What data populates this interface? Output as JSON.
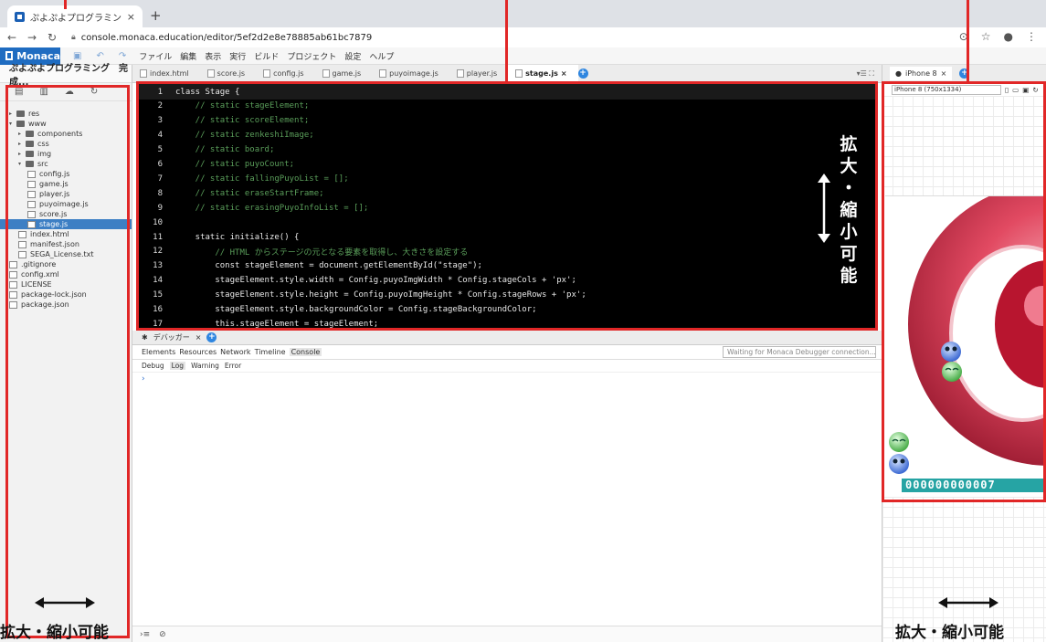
{
  "browser": {
    "tab_title": "ぷよぷよプログラミング 完成",
    "url": "console.monaca.education/editor/5ef2d2e8e78885ab61bc7879"
  },
  "app": {
    "logo": "Monaca",
    "menus": [
      "ファイル",
      "編集",
      "表示",
      "実行",
      "ビルド",
      "プロジェクト",
      "設定",
      "ヘルプ"
    ]
  },
  "project": {
    "title": "ぷよぷよプログラミング　完成...",
    "tree": [
      {
        "label": "res",
        "kind": "folder",
        "depth": 0,
        "arrow": "▸"
      },
      {
        "label": "www",
        "kind": "folder",
        "depth": 0,
        "arrow": "▾"
      },
      {
        "label": "components",
        "kind": "folder",
        "depth": 1,
        "arrow": "▸"
      },
      {
        "label": "css",
        "kind": "folder",
        "depth": 1,
        "arrow": "▸"
      },
      {
        "label": "img",
        "kind": "folder",
        "depth": 1,
        "arrow": "▸"
      },
      {
        "label": "src",
        "kind": "folder",
        "depth": 1,
        "arrow": "▾"
      },
      {
        "label": "config.js",
        "kind": "file",
        "depth": 2
      },
      {
        "label": "game.js",
        "kind": "file",
        "depth": 2
      },
      {
        "label": "player.js",
        "kind": "file",
        "depth": 2
      },
      {
        "label": "puyoimage.js",
        "kind": "file",
        "depth": 2
      },
      {
        "label": "score.js",
        "kind": "file",
        "depth": 2
      },
      {
        "label": "stage.js",
        "kind": "file",
        "depth": 2,
        "selected": true
      },
      {
        "label": "index.html",
        "kind": "file",
        "depth": 1
      },
      {
        "label": "manifest.json",
        "kind": "file",
        "depth": 1
      },
      {
        "label": "SEGA_License.txt",
        "kind": "file",
        "depth": 1
      },
      {
        "label": ".gitignore",
        "kind": "file",
        "depth": 0
      },
      {
        "label": "config.xml",
        "kind": "file",
        "depth": 0
      },
      {
        "label": "LICENSE",
        "kind": "file",
        "depth": 0
      },
      {
        "label": "package-lock.json",
        "kind": "file",
        "depth": 0
      },
      {
        "label": "package.json",
        "kind": "file",
        "depth": 0
      }
    ]
  },
  "editor": {
    "tabs": [
      "index.html",
      "score.js",
      "config.js",
      "game.js",
      "puyoimage.js",
      "player.js",
      "stage.js"
    ],
    "active_tab": "stage.js",
    "lines": [
      {
        "n": "1",
        "code": "class Stage {",
        "color": "#e8e8e8"
      },
      {
        "n": "2",
        "code": "    // static stageElement;",
        "color": "#5a9e5a"
      },
      {
        "n": "3",
        "code": "    // static scoreElement;",
        "color": "#5a9e5a"
      },
      {
        "n": "4",
        "code": "    // static zenkeshiImage;",
        "color": "#5a9e5a"
      },
      {
        "n": "5",
        "code": "    // static board;",
        "color": "#5a9e5a"
      },
      {
        "n": "6",
        "code": "    // static puyoCount;",
        "color": "#5a9e5a"
      },
      {
        "n": "7",
        "code": "    // static fallingPuyoList = [];",
        "color": "#5a9e5a"
      },
      {
        "n": "8",
        "code": "    // static eraseStartFrame;",
        "color": "#5a9e5a"
      },
      {
        "n": "9",
        "code": "    // static erasingPuyoInfoList = [];",
        "color": "#5a9e5a"
      },
      {
        "n": "10",
        "code": "",
        "color": "#e8e8e8"
      },
      {
        "n": "11",
        "code": "    static initialize() {",
        "color": "#e8e8e8"
      },
      {
        "n": "12",
        "code": "        // HTML からステージの元となる要素を取得し、大きさを設定する",
        "color": "#5a9e5a"
      },
      {
        "n": "13",
        "code": "        const stageElement = document.getElementById(\"stage\");",
        "color": "#e8e8e8"
      },
      {
        "n": "14",
        "code": "        stageElement.style.width = Config.puyoImgWidth * Config.stageCols + 'px';",
        "color": "#e8e8e8"
      },
      {
        "n": "15",
        "code": "        stageElement.style.height = Config.puyoImgHeight * Config.stageRows + 'px';",
        "color": "#e8e8e8"
      },
      {
        "n": "16",
        "code": "        stageElement.style.backgroundColor = Config.stageBackgroundColor;",
        "color": "#e8e8e8"
      },
      {
        "n": "17",
        "code": "        this.stageElement = stageElement;",
        "color": "#e8e8e8"
      }
    ]
  },
  "debugger": {
    "title": "デバッガー",
    "tabs": [
      "Elements",
      "Resources",
      "Network",
      "Timeline",
      "Console"
    ],
    "active_tab": "Console",
    "log_tabs": [
      "Debug",
      "Log",
      "Warning",
      "Error"
    ],
    "active_log_tab": "Log",
    "status": "Waiting for Monaca Debugger connection...",
    "prompt": "›"
  },
  "preview": {
    "tab": "iPhone 8",
    "device": "iPhone 8 (750x1334)",
    "score": "000000000007"
  },
  "annotations": {
    "resize_label": "拡大・縮小可能",
    "vertical_chars": [
      "拡",
      "大",
      "・",
      "縮",
      "小",
      "可",
      "能"
    ]
  },
  "colors": {
    "highlight": "#e12727",
    "accent": "#1f6cc1",
    "selection": "#3d7fc4",
    "score_bg": "#26a4a4"
  }
}
